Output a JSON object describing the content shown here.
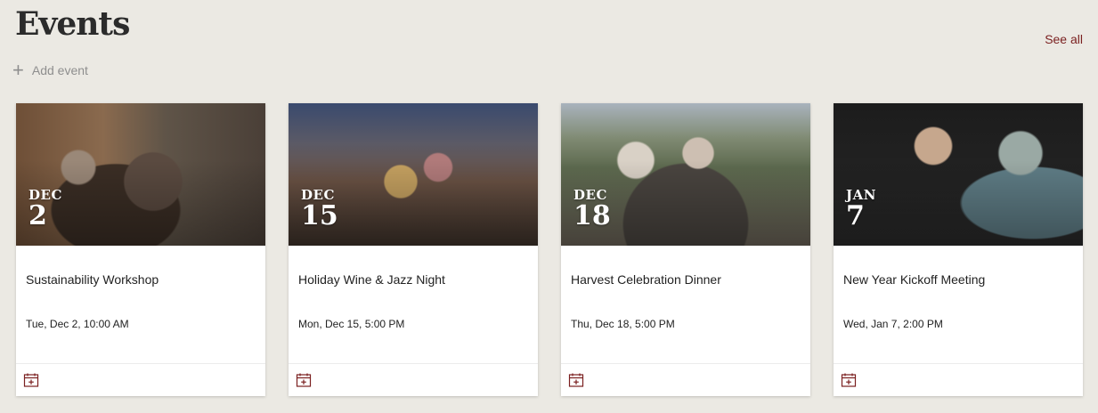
{
  "header": {
    "title": "Events",
    "see_all": "See all",
    "add_event": "Add event"
  },
  "events": [
    {
      "month": "DEC",
      "day": "2",
      "title": "Sustainability Workshop",
      "datetime": "Tue, Dec 2, 10:00 AM"
    },
    {
      "month": "DEC",
      "day": "15",
      "title": "Holiday Wine & Jazz Night",
      "datetime": "Mon, Dec 15, 5:00 PM"
    },
    {
      "month": "DEC",
      "day": "18",
      "title": "Harvest Celebration Dinner",
      "datetime": "Thu, Dec 18, 5:00 PM"
    },
    {
      "month": "JAN",
      "day": "7",
      "title": "New Year Kickoff Meeting",
      "datetime": "Wed, Jan 7, 2:00 PM"
    }
  ],
  "colors": {
    "background": "#ebe9e3",
    "accent": "#7a1f1f",
    "text": "#222222"
  },
  "icons": {
    "add": "plus-icon",
    "calendar": "calendar-add-icon"
  }
}
